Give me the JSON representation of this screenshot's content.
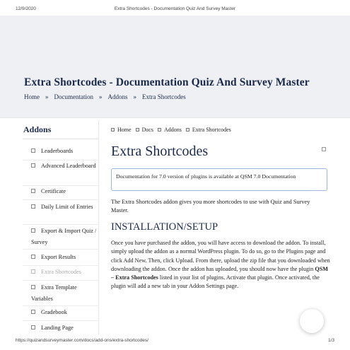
{
  "print_header": {
    "date": "12/9/2020",
    "title": "Extra Shortcodes - Documentation Quiz And Survey Master"
  },
  "hero": {
    "title": "Extra Shortcodes - Documentation Quiz And Survey Master",
    "breadcrumb": [
      "Home",
      "Documentation",
      "Addons",
      "Extra Shortcodes"
    ],
    "separator": "»"
  },
  "sidebar": {
    "title": "Addons",
    "items": [
      {
        "label": "Leaderboards",
        "active": false
      },
      {
        "label": "Advanced Leaderboard",
        "active": false
      },
      {
        "label": "Certificate",
        "active": false
      },
      {
        "label": "Daily Limit of Entries",
        "active": false
      },
      {
        "label": "Export & Import Quiz / Survey",
        "active": false
      },
      {
        "label": "Export Results",
        "active": false
      },
      {
        "label": "Extra Shortcodes",
        "active": true
      },
      {
        "label": "Extra Template Variables",
        "active": false
      },
      {
        "label": "Gradebook",
        "active": false
      },
      {
        "label": "Landing Page",
        "active": false
      }
    ]
  },
  "main": {
    "breadcrumb": [
      "Home",
      "Docs",
      "Addons",
      "Extra Shortcodes"
    ],
    "title": "Extra Shortcodes",
    "notice": "Documentation for 7.0 version of plugins is available at QSM 7.0 Documentation",
    "intro": "The Extra Shortcodes addon gives you more shortcodes to use with Quiz and Survey Master.",
    "section_heading": "INSTALLATION/SETUP",
    "body_part1": "Once you have purchased the addon, you will have access to download the addon. To install, simply upload the addon as a normal WordPress plugin. To do so, go to the Plugins page and click Add New. Then, click Upload. From there, upload the zip file that you downloaded when downloading the addon. Once the addon has uploaded, you should now have the plugin ",
    "body_bold": "QSM – Extra Shortcodes",
    "body_part2": " listed in your list of plugins. Activate that plugin. Once activated, the plugin will add a new tab in your Addon Settings page."
  },
  "print_footer": {
    "url": "https://quizandsurveymaster.com/docs/add-ons/extra-shortcodes/",
    "page": "1/3"
  }
}
